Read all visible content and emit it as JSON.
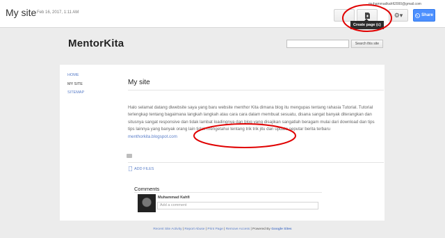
{
  "header": {
    "site_title": "My site",
    "date": "Feb 16, 2017, 1:11 AM",
    "user_email": "muhammadkahfi2000@gmail.com",
    "tooltip": "Create page (c)",
    "share_label": "Share"
  },
  "brand": "MentorKita",
  "search": {
    "placeholder": "",
    "button": "Search this site"
  },
  "nav": {
    "items": [
      "HOME",
      "MY SITE",
      "SITEMAP"
    ]
  },
  "page": {
    "title": "My site",
    "body": "Halo selamat datang diwebsite saya yang baru website menthor Kita dimana blog itu mengupas tentang rahasia Tutorial. Tutorial terlengkap tentang bagaimana langkah langkah atau cara cara dalam membuat sesuatu, disana sangat banyak diterangkan dan situsnya sangat responsive dan tidak lambat loadingnya dan blog yang disajikan sangatlah beragam mulai dari download dan tips tips lainnya yang banyak orang lain tidak mengetahui tentang trik trik jitu dan update seputar berita terbaru",
    "link": "menthorkita.blogspot.com",
    "add_files": "ADD FILES"
  },
  "comments": {
    "title": "Comments",
    "author": "Muhammad Kahfi",
    "placeholder": "Add a comment"
  },
  "footer": {
    "links": [
      "Recent Site Activity",
      "Report Abuse",
      "Print Page",
      "Remove Access"
    ],
    "powered": "Powered By",
    "brand": "Google Sites"
  },
  "colors": {
    "accent": "#4d90fe",
    "link": "#5a7ec9",
    "annotation": "#e00000"
  },
  "icons": [
    "create-page-icon",
    "gear-icon",
    "globe-icon",
    "folder-icon",
    "file-icon"
  ]
}
